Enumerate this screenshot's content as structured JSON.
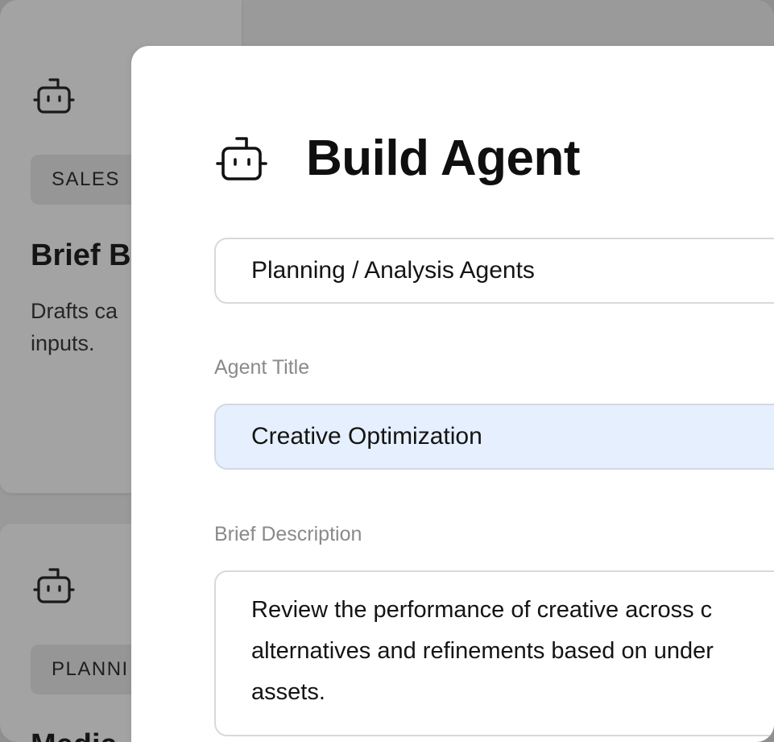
{
  "background_cards": [
    {
      "tag": "SALES",
      "title": "Brief B",
      "description_lines": [
        "Drafts ca",
        "inputs."
      ],
      "icon": "robot-icon"
    },
    {
      "tag": "PLANNI",
      "title": "Media",
      "icon": "robot-icon"
    }
  ],
  "modal": {
    "icon": "robot-icon",
    "title": "Build Agent",
    "category_select": {
      "value": "Planning / Analysis Agents"
    },
    "agent_title": {
      "label": "Agent Title",
      "value": "Creative Optimization"
    },
    "brief_description": {
      "label": "Brief Description",
      "lines": [
        "Review the performance of creative across c",
        "alternatives and refinements based on under",
        "assets."
      ]
    }
  },
  "colors": {
    "overlay": "#9a9a9a",
    "modal_bg": "#ffffff",
    "input_highlight": "#e6effd",
    "border": "#d9d9d9",
    "label": "#8a8a8a"
  }
}
